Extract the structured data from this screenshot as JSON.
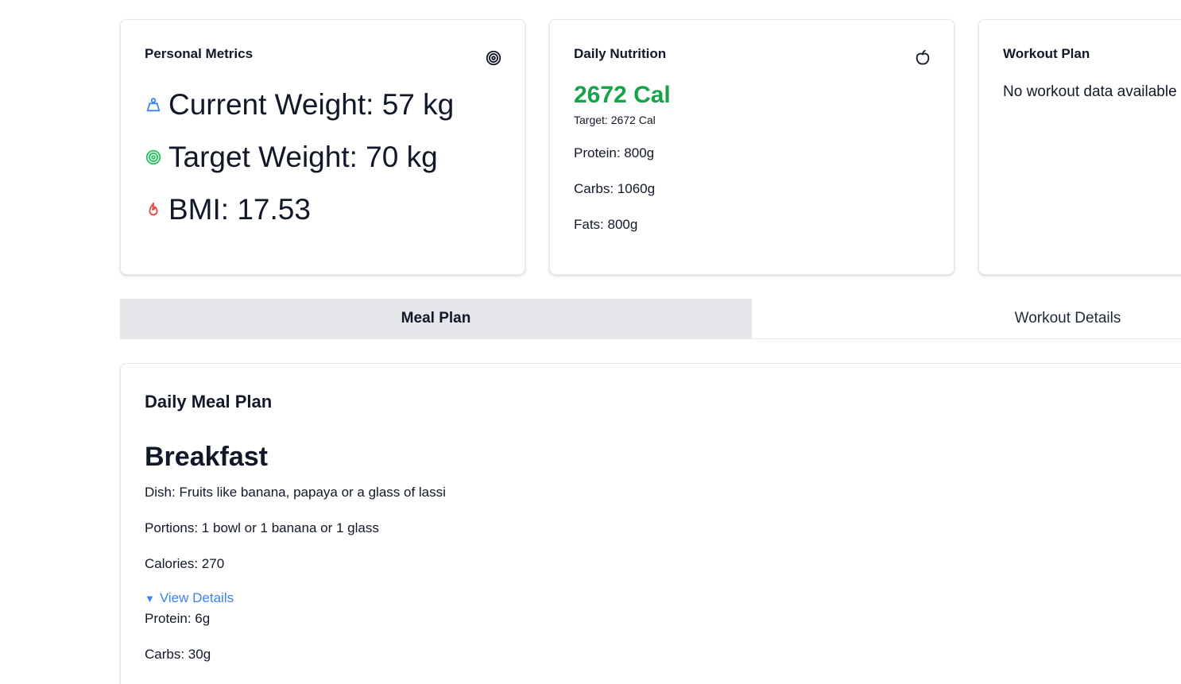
{
  "metrics": {
    "title": "Personal Metrics",
    "current_weight": "Current Weight: 57 kg",
    "target_weight": "Target Weight: 70 kg",
    "bmi": "BMI: 17.53",
    "icons": {
      "header": "target-icon",
      "current_weight": "weight-icon",
      "target_weight": "target-icon",
      "bmi": "flame-icon"
    },
    "colors": {
      "weight_icon": "#3b82f6",
      "target_icon": "#22c55e",
      "flame_icon": "#ef4444"
    }
  },
  "nutrition": {
    "title": "Daily Nutrition",
    "calories": "2672 Cal",
    "target": "Target: 2672 Cal",
    "protein": "Protein: 800g",
    "carbs": "Carbs: 1060g",
    "fats": "Fats: 800g",
    "icon": "apple-icon",
    "calories_color": "#16a34a"
  },
  "workout": {
    "title": "Workout Plan",
    "empty_text": "No workout data available"
  },
  "tabs": [
    {
      "label": "Meal Plan",
      "active": true
    },
    {
      "label": "Workout Details",
      "active": false
    }
  ],
  "meal_plan": {
    "title": "Daily Meal Plan",
    "meals": [
      {
        "name": "Breakfast",
        "dish": "Dish: Fruits like banana, papaya or a glass of lassi",
        "portions": "Portions: 1 bowl or 1 banana or 1 glass",
        "calories": "Calories: 270",
        "details_label": "View Details",
        "details": {
          "protein": "Protein: 6g",
          "carbs": "Carbs: 30g"
        }
      }
    ],
    "link_color": "#3b82f6"
  }
}
